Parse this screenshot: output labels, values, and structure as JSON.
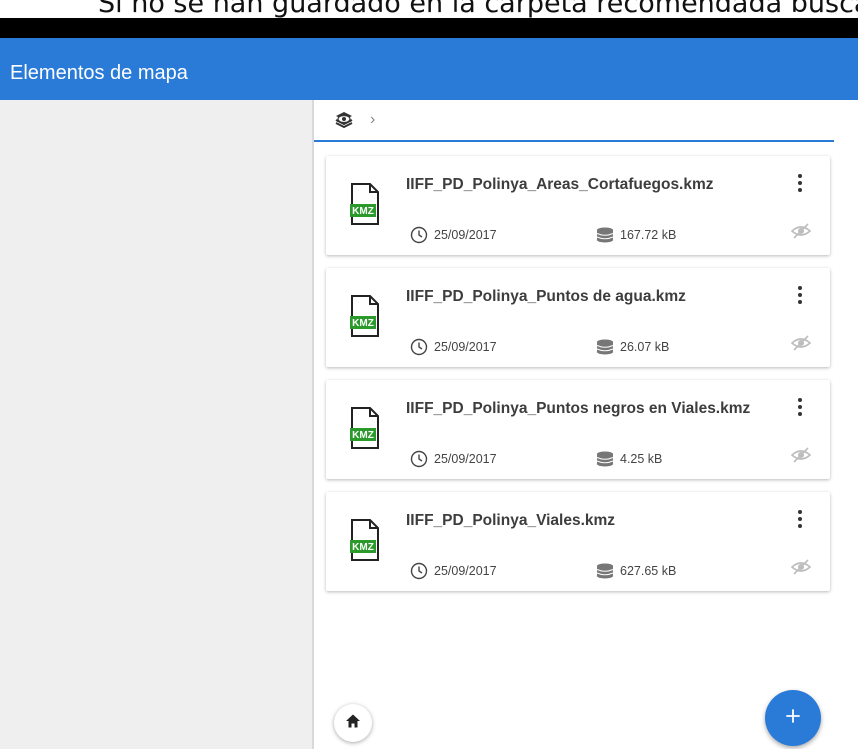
{
  "document": {
    "top_text": "Si no se han guardado en la carpeta recomendada buscar la"
  },
  "app_bar": {
    "title": "Elementos de mapa",
    "color": "#2a7bd8"
  },
  "breadcrumb": {
    "root_icon": "layers-eye-icon",
    "separator": "›"
  },
  "files": [
    {
      "name": "IIFF_PD_Polinya_Areas_Cortafuegos.kmz",
      "date": "25/09/2017",
      "size": "167.72 kB",
      "badge": "KMZ"
    },
    {
      "name": "IIFF_PD_Polinya_Puntos de agua.kmz",
      "date": "25/09/2017",
      "size": "26.07 kB",
      "badge": "KMZ"
    },
    {
      "name": "IIFF_PD_Polinya_Puntos negros en Viales.kmz",
      "date": "25/09/2017",
      "size": "4.25 kB",
      "badge": "KMZ"
    },
    {
      "name": "IIFF_PD_Polinya_Viales.kmz",
      "date": "25/09/2017",
      "size": "627.65 kB",
      "badge": "KMZ"
    }
  ],
  "actions": {
    "home_icon": "home-icon",
    "add_icon": "plus-icon"
  },
  "colors": {
    "accent": "#2a7bd8",
    "kmz_green": "#2a9a2a",
    "panel_gray": "#efefef"
  }
}
